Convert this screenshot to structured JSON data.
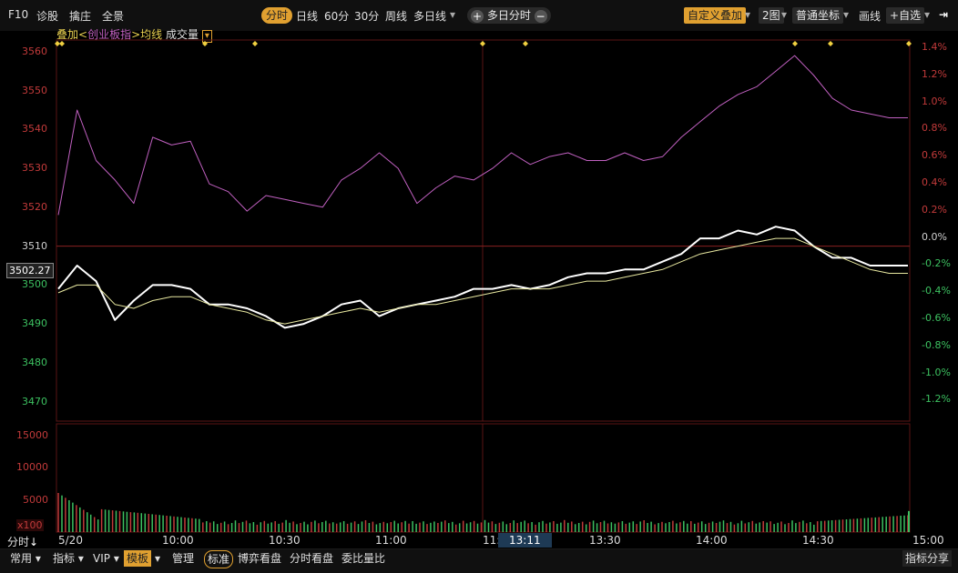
{
  "toolbar": {
    "left_items": [
      "F10",
      "诊股",
      "擒庄",
      "全景"
    ],
    "periods": [
      "分时",
      "日线",
      "60分",
      "30分",
      "周线",
      "多日线"
    ],
    "active_period": "分时",
    "multi_day": "多日分时",
    "plus": "+",
    "minus": "−",
    "custom_overlay": "自定义叠加",
    "two_charts": "2图",
    "coord": "普通坐标",
    "draw": "画线",
    "watchlist": "自选",
    "arrow_menu": "▾",
    "expand": "⇥"
  },
  "legend": {
    "overlay": "叠加<",
    "index_name": "创业板指",
    "after": ">均线",
    "volume": "成交量",
    "dropdown": "▾"
  },
  "price_axis": {
    "ticks": [
      3560,
      3550,
      3540,
      3530,
      3520,
      3510,
      3500,
      3490,
      3480,
      3470
    ],
    "current_price": "3502.27"
  },
  "pct_axis": {
    "ticks": [
      "1.4%",
      "1.2%",
      "1.0%",
      "0.8%",
      "0.6%",
      "0.4%",
      "0.2%",
      "0.0%",
      "-0.2%",
      "-0.4%",
      "-0.6%",
      "-0.8%",
      "-1.0%",
      "-1.2%"
    ]
  },
  "volume_axis": {
    "ticks": [
      "15000",
      "10000",
      "5000"
    ],
    "unit": "x100"
  },
  "time_axis": {
    "labels": [
      "5/20",
      "10:00",
      "10:30",
      "11:00",
      "11:",
      "13:11",
      "13:30",
      "14:00",
      "14:30",
      "15:00"
    ],
    "cursor_time": "13:11",
    "mode": "分时"
  },
  "bottom_bar": {
    "left": [
      "常用",
      "指标",
      "VIP",
      "模板"
    ],
    "manage": "管理",
    "tabs": [
      "标准",
      "博弈看盘",
      "分时看盘",
      "委比量比"
    ],
    "right": "指标分享"
  },
  "colors": {
    "accent": "#e0a030",
    "overlay_line": "#c060c0",
    "price_line": "#ffffff",
    "avg_line": "#e8e8a0",
    "up": "#c23a3a",
    "down": "#3cc060",
    "grid": "#5a1515"
  },
  "chart_data": {
    "type": "line",
    "x": [
      "09:30",
      "09:33",
      "09:36",
      "09:39",
      "09:42",
      "09:45",
      "09:48",
      "09:51",
      "09:54",
      "09:57",
      "10:00",
      "10:06",
      "10:12",
      "10:18",
      "10:24",
      "10:30",
      "10:36",
      "10:42",
      "10:48",
      "10:54",
      "11:00",
      "11:06",
      "11:12",
      "11:18",
      "11:24",
      "11:30",
      "13:06",
      "13:12",
      "13:18",
      "13:24",
      "13:30",
      "13:36",
      "13:42",
      "13:48",
      "13:54",
      "14:00",
      "14:06",
      "14:12",
      "14:18",
      "14:24",
      "14:30",
      "14:36",
      "14:42",
      "14:48",
      "14:54",
      "15:00"
    ],
    "series": [
      {
        "name": "创业板指",
        "values": [
          3518,
          3545,
          3532,
          3527,
          3521,
          3538,
          3536,
          3537,
          3526,
          3524,
          3519,
          3523,
          3522,
          3521,
          3520,
          3527,
          3530,
          3534,
          3530,
          3521,
          3525,
          3528,
          3527,
          3530,
          3534,
          3531,
          3533,
          3534,
          3532,
          3532,
          3534,
          3532,
          3533,
          3538,
          3542,
          3546,
          3549,
          3551,
          3555,
          3559,
          3554,
          3548,
          3545,
          3544,
          3543,
          3543
        ]
      },
      {
        "name": "价格",
        "values": [
          3499,
          3505,
          3501,
          3491,
          3496,
          3500,
          3500,
          3499,
          3495,
          3495,
          3494,
          3492,
          3489,
          3490,
          3492,
          3495,
          3496,
          3492,
          3494,
          3495,
          3496,
          3497,
          3499,
          3499,
          3500,
          3499,
          3500,
          3502,
          3503,
          3503,
          3504,
          3504,
          3506,
          3508,
          3512,
          3512,
          3514,
          3513,
          3515,
          3514,
          3510,
          3507,
          3507,
          3505,
          3505,
          3505
        ]
      },
      {
        "name": "均线",
        "values": [
          3498,
          3500,
          3500,
          3495,
          3494,
          3496,
          3497,
          3497,
          3495,
          3494,
          3493,
          3491,
          3490,
          3491,
          3492,
          3493,
          3494,
          3493,
          3494,
          3495,
          3495,
          3496,
          3497,
          3498,
          3499,
          3499,
          3499,
          3500,
          3501,
          3501,
          3502,
          3503,
          3504,
          3506,
          3508,
          3509,
          3510,
          3511,
          3512,
          3512,
          3510,
          3508,
          3506,
          3504,
          3503,
          3503
        ]
      }
    ],
    "ylim": [
      3465,
      3563
    ],
    "volume_ylim": [
      0,
      18000
    ]
  }
}
